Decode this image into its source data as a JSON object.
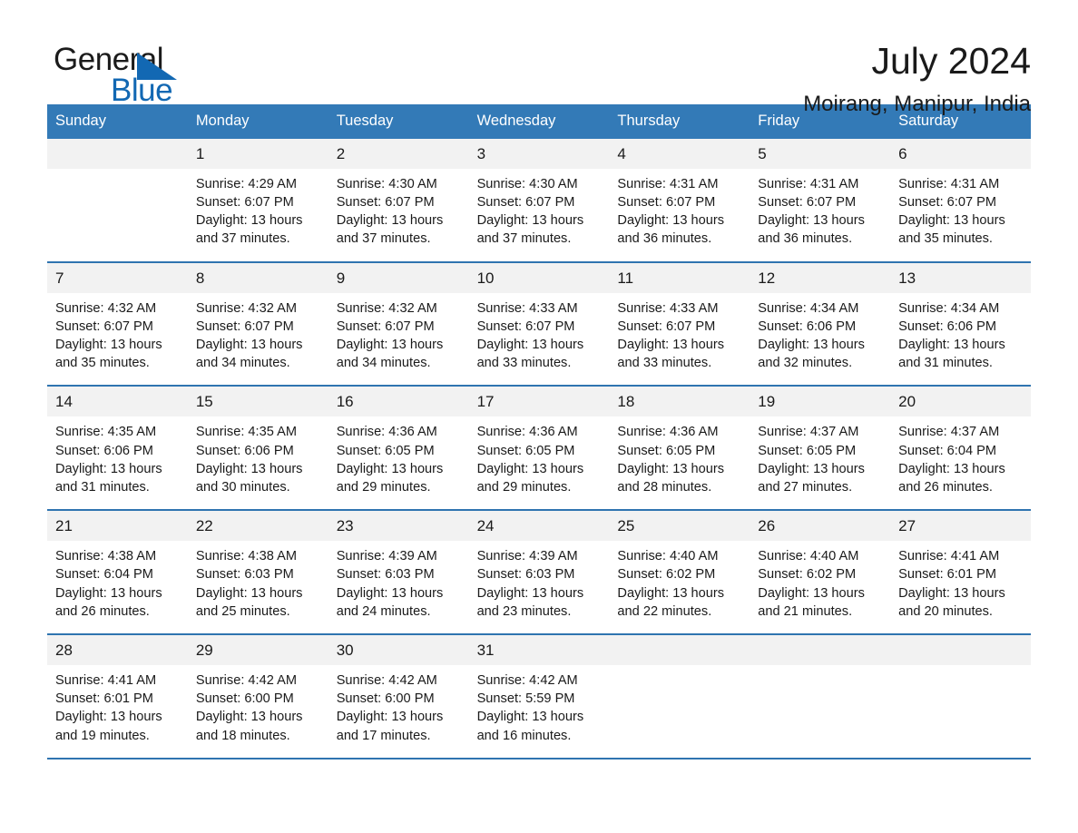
{
  "brand": {
    "name_part1": "General",
    "name_part2": "Blue",
    "accent_color": "#1268b3"
  },
  "header": {
    "title": "July 2024",
    "location": "Moirang, Manipur, India"
  },
  "theme": {
    "header_bar_color": "#337ab7",
    "daynum_band_color": "#f2f2f2",
    "week_divider_color": "#2f74b0"
  },
  "calendar": {
    "weekdays": [
      "Sunday",
      "Monday",
      "Tuesday",
      "Wednesday",
      "Thursday",
      "Friday",
      "Saturday"
    ],
    "weeks": [
      [
        {
          "day": "",
          "sunrise": "",
          "sunset": "",
          "daylight": ""
        },
        {
          "day": "1",
          "sunrise": "Sunrise: 4:29 AM",
          "sunset": "Sunset: 6:07 PM",
          "daylight": "Daylight: 13 hours and 37 minutes."
        },
        {
          "day": "2",
          "sunrise": "Sunrise: 4:30 AM",
          "sunset": "Sunset: 6:07 PM",
          "daylight": "Daylight: 13 hours and 37 minutes."
        },
        {
          "day": "3",
          "sunrise": "Sunrise: 4:30 AM",
          "sunset": "Sunset: 6:07 PM",
          "daylight": "Daylight: 13 hours and 37 minutes."
        },
        {
          "day": "4",
          "sunrise": "Sunrise: 4:31 AM",
          "sunset": "Sunset: 6:07 PM",
          "daylight": "Daylight: 13 hours and 36 minutes."
        },
        {
          "day": "5",
          "sunrise": "Sunrise: 4:31 AM",
          "sunset": "Sunset: 6:07 PM",
          "daylight": "Daylight: 13 hours and 36 minutes."
        },
        {
          "day": "6",
          "sunrise": "Sunrise: 4:31 AM",
          "sunset": "Sunset: 6:07 PM",
          "daylight": "Daylight: 13 hours and 35 minutes."
        }
      ],
      [
        {
          "day": "7",
          "sunrise": "Sunrise: 4:32 AM",
          "sunset": "Sunset: 6:07 PM",
          "daylight": "Daylight: 13 hours and 35 minutes."
        },
        {
          "day": "8",
          "sunrise": "Sunrise: 4:32 AM",
          "sunset": "Sunset: 6:07 PM",
          "daylight": "Daylight: 13 hours and 34 minutes."
        },
        {
          "day": "9",
          "sunrise": "Sunrise: 4:32 AM",
          "sunset": "Sunset: 6:07 PM",
          "daylight": "Daylight: 13 hours and 34 minutes."
        },
        {
          "day": "10",
          "sunrise": "Sunrise: 4:33 AM",
          "sunset": "Sunset: 6:07 PM",
          "daylight": "Daylight: 13 hours and 33 minutes."
        },
        {
          "day": "11",
          "sunrise": "Sunrise: 4:33 AM",
          "sunset": "Sunset: 6:07 PM",
          "daylight": "Daylight: 13 hours and 33 minutes."
        },
        {
          "day": "12",
          "sunrise": "Sunrise: 4:34 AM",
          "sunset": "Sunset: 6:06 PM",
          "daylight": "Daylight: 13 hours and 32 minutes."
        },
        {
          "day": "13",
          "sunrise": "Sunrise: 4:34 AM",
          "sunset": "Sunset: 6:06 PM",
          "daylight": "Daylight: 13 hours and 31 minutes."
        }
      ],
      [
        {
          "day": "14",
          "sunrise": "Sunrise: 4:35 AM",
          "sunset": "Sunset: 6:06 PM",
          "daylight": "Daylight: 13 hours and 31 minutes."
        },
        {
          "day": "15",
          "sunrise": "Sunrise: 4:35 AM",
          "sunset": "Sunset: 6:06 PM",
          "daylight": "Daylight: 13 hours and 30 minutes."
        },
        {
          "day": "16",
          "sunrise": "Sunrise: 4:36 AM",
          "sunset": "Sunset: 6:05 PM",
          "daylight": "Daylight: 13 hours and 29 minutes."
        },
        {
          "day": "17",
          "sunrise": "Sunrise: 4:36 AM",
          "sunset": "Sunset: 6:05 PM",
          "daylight": "Daylight: 13 hours and 29 minutes."
        },
        {
          "day": "18",
          "sunrise": "Sunrise: 4:36 AM",
          "sunset": "Sunset: 6:05 PM",
          "daylight": "Daylight: 13 hours and 28 minutes."
        },
        {
          "day": "19",
          "sunrise": "Sunrise: 4:37 AM",
          "sunset": "Sunset: 6:05 PM",
          "daylight": "Daylight: 13 hours and 27 minutes."
        },
        {
          "day": "20",
          "sunrise": "Sunrise: 4:37 AM",
          "sunset": "Sunset: 6:04 PM",
          "daylight": "Daylight: 13 hours and 26 minutes."
        }
      ],
      [
        {
          "day": "21",
          "sunrise": "Sunrise: 4:38 AM",
          "sunset": "Sunset: 6:04 PM",
          "daylight": "Daylight: 13 hours and 26 minutes."
        },
        {
          "day": "22",
          "sunrise": "Sunrise: 4:38 AM",
          "sunset": "Sunset: 6:03 PM",
          "daylight": "Daylight: 13 hours and 25 minutes."
        },
        {
          "day": "23",
          "sunrise": "Sunrise: 4:39 AM",
          "sunset": "Sunset: 6:03 PM",
          "daylight": "Daylight: 13 hours and 24 minutes."
        },
        {
          "day": "24",
          "sunrise": "Sunrise: 4:39 AM",
          "sunset": "Sunset: 6:03 PM",
          "daylight": "Daylight: 13 hours and 23 minutes."
        },
        {
          "day": "25",
          "sunrise": "Sunrise: 4:40 AM",
          "sunset": "Sunset: 6:02 PM",
          "daylight": "Daylight: 13 hours and 22 minutes."
        },
        {
          "day": "26",
          "sunrise": "Sunrise: 4:40 AM",
          "sunset": "Sunset: 6:02 PM",
          "daylight": "Daylight: 13 hours and 21 minutes."
        },
        {
          "day": "27",
          "sunrise": "Sunrise: 4:41 AM",
          "sunset": "Sunset: 6:01 PM",
          "daylight": "Daylight: 13 hours and 20 minutes."
        }
      ],
      [
        {
          "day": "28",
          "sunrise": "Sunrise: 4:41 AM",
          "sunset": "Sunset: 6:01 PM",
          "daylight": "Daylight: 13 hours and 19 minutes."
        },
        {
          "day": "29",
          "sunrise": "Sunrise: 4:42 AM",
          "sunset": "Sunset: 6:00 PM",
          "daylight": "Daylight: 13 hours and 18 minutes."
        },
        {
          "day": "30",
          "sunrise": "Sunrise: 4:42 AM",
          "sunset": "Sunset: 6:00 PM",
          "daylight": "Daylight: 13 hours and 17 minutes."
        },
        {
          "day": "31",
          "sunrise": "Sunrise: 4:42 AM",
          "sunset": "Sunset: 5:59 PM",
          "daylight": "Daylight: 13 hours and 16 minutes."
        },
        {
          "day": "",
          "sunrise": "",
          "sunset": "",
          "daylight": ""
        },
        {
          "day": "",
          "sunrise": "",
          "sunset": "",
          "daylight": ""
        },
        {
          "day": "",
          "sunrise": "",
          "sunset": "",
          "daylight": ""
        }
      ]
    ]
  }
}
